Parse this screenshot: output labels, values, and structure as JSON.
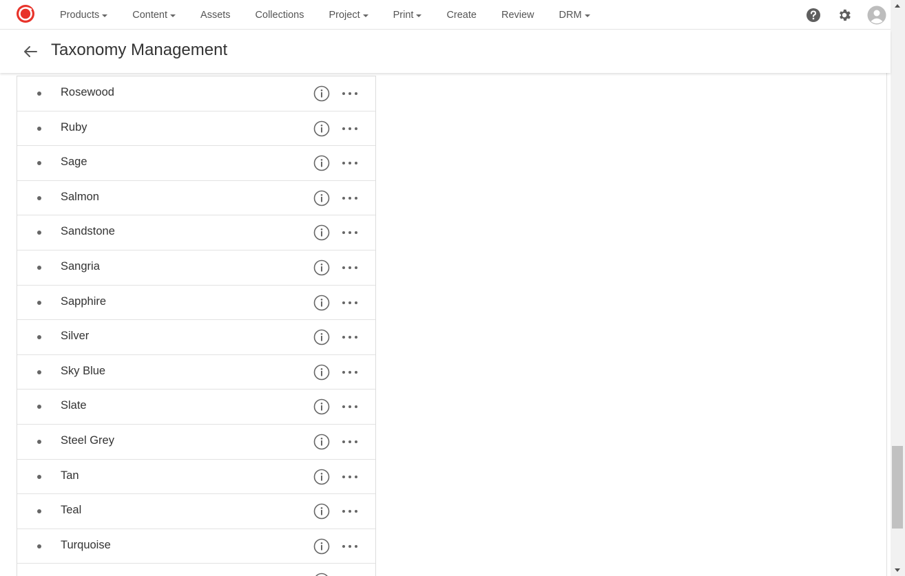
{
  "nav": {
    "items": [
      {
        "label": "Products",
        "dropdown": true
      },
      {
        "label": "Content",
        "dropdown": true
      },
      {
        "label": "Assets",
        "dropdown": false
      },
      {
        "label": "Collections",
        "dropdown": false
      },
      {
        "label": "Project",
        "dropdown": true
      },
      {
        "label": "Print",
        "dropdown": true
      },
      {
        "label": "Create",
        "dropdown": false
      },
      {
        "label": "Review",
        "dropdown": false
      },
      {
        "label": "DRM",
        "dropdown": true
      }
    ],
    "icons": [
      "help-icon",
      "gear-icon",
      "user-avatar-icon"
    ]
  },
  "header": {
    "title": "Taxonomy Management"
  },
  "tree": {
    "terms": [
      "Rosewood",
      "Ruby",
      "Sage",
      "Salmon",
      "Sandstone",
      "Sangria",
      "Sapphire",
      "Silver",
      "Sky Blue",
      "Slate",
      "Steel Grey",
      "Tan",
      "Teal",
      "Turquoise",
      ""
    ]
  },
  "colors": {
    "brand": "#e8332a",
    "icon": "#666666",
    "text": "#333333"
  }
}
